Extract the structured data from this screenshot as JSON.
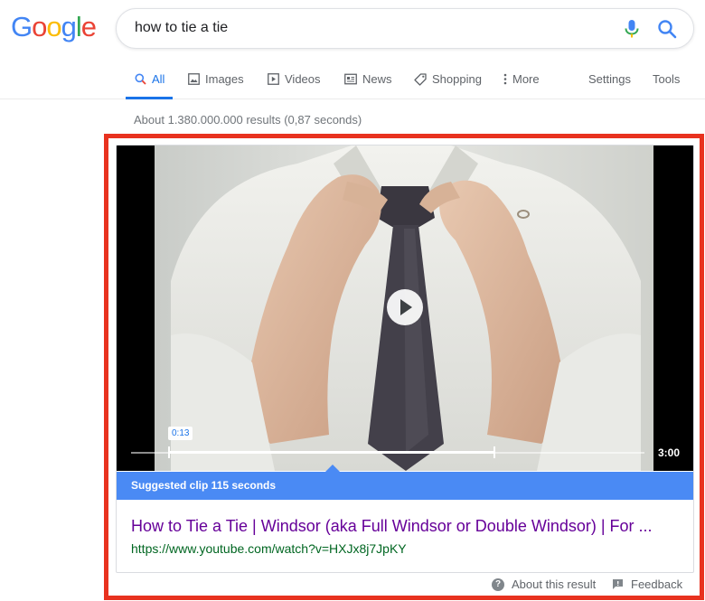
{
  "logo": {
    "letters": [
      "G",
      "o",
      "o",
      "g",
      "l",
      "e"
    ],
    "colors": [
      "#4285f4",
      "#ea4335",
      "#fbbc05",
      "#4285f4",
      "#34a853",
      "#ea4335"
    ]
  },
  "search": {
    "query": "how to tie a tie",
    "icons": [
      "microphone-icon",
      "search-icon"
    ]
  },
  "tabs": [
    {
      "label": "All",
      "icon": "search-icon",
      "active": true
    },
    {
      "label": "Images",
      "icon": "image-icon",
      "active": false
    },
    {
      "label": "Videos",
      "icon": "video-icon",
      "active": false
    },
    {
      "label": "News",
      "icon": "news-icon",
      "active": false
    },
    {
      "label": "Shopping",
      "icon": "tag-icon",
      "active": false
    },
    {
      "label": "More",
      "icon": "more-vertical-icon",
      "active": false
    }
  ],
  "tools": {
    "settings": "Settings",
    "tools": "Tools"
  },
  "result_stats": "About 1.380.000.000 results (0,87 seconds)",
  "video": {
    "clip_start": "0:13",
    "duration": "3:00",
    "suggested_clip": "Suggested clip 115 seconds"
  },
  "result": {
    "title": "How to Tie a Tie | Windsor (aka Full Windsor or Double Windsor) | For ...",
    "url": "https://www.youtube.com/watch?v=HXJx8j7JpKY"
  },
  "footer": {
    "about": "About this result",
    "feedback": "Feedback"
  },
  "colors": {
    "accent": "#1a73e8",
    "highlight_border": "#e8321f",
    "suggested_bar": "#4a8af4",
    "visited_link": "#660099",
    "url_green": "#006621"
  }
}
